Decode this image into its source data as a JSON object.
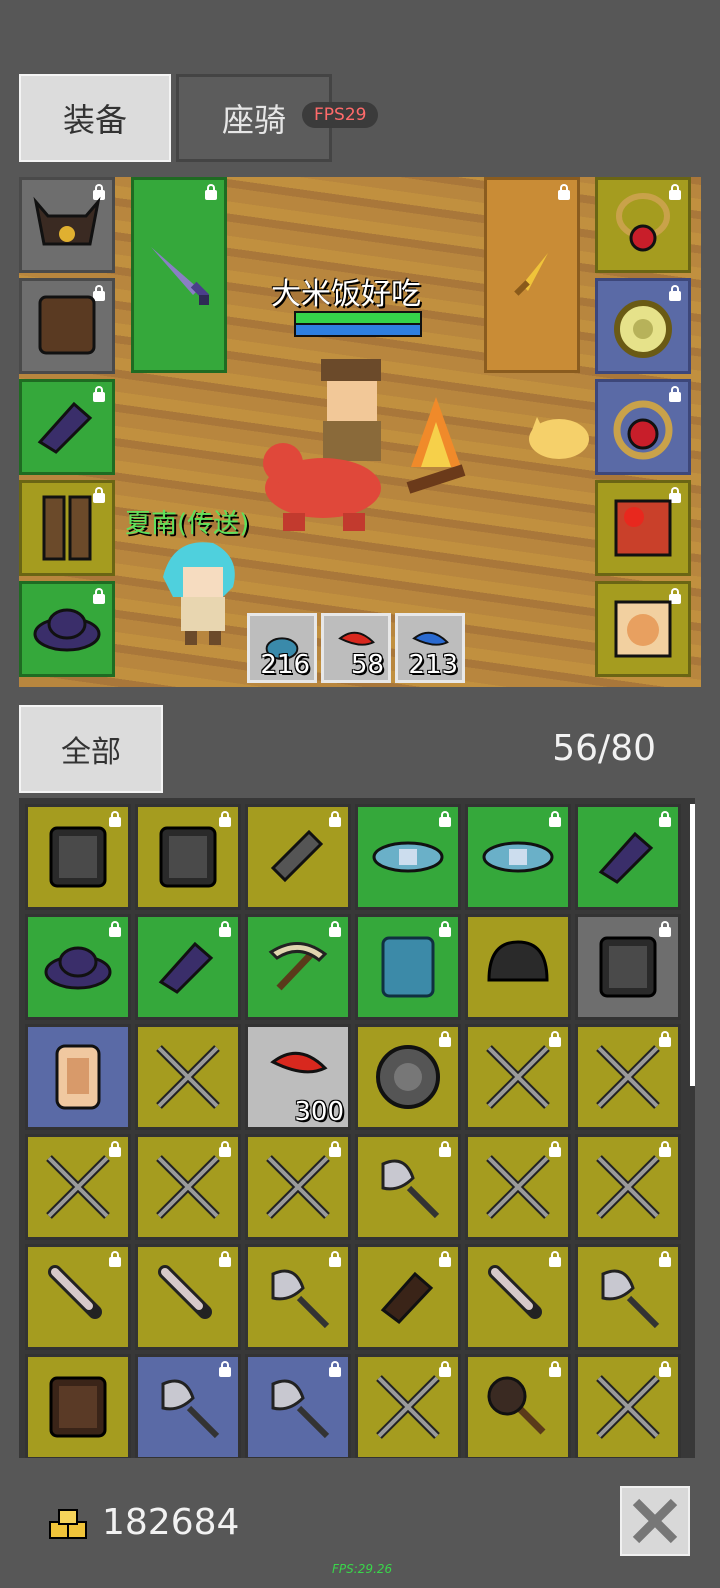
{
  "tabs": {
    "equipment": "装备",
    "mount": "座骑"
  },
  "fps_badge": "FPS29",
  "scene": {
    "player_name": "大米饭好吃",
    "npc_name": "夏南(传送)",
    "hp_color": "#35d34a",
    "mp_color": "#2f7fe0",
    "consumables": [
      {
        "icon": "blue-potion-icon",
        "count": "216"
      },
      {
        "icon": "red-feather-icon",
        "count": "58"
      },
      {
        "icon": "blue-feather-icon",
        "count": "213"
      }
    ]
  },
  "equip_slots_left": [
    {
      "icon": "horned-helmet-icon",
      "rarity": "grey"
    },
    {
      "icon": "leather-armor-icon",
      "rarity": "grey"
    },
    {
      "icon": "purple-gloves-icon",
      "rarity": "green"
    },
    {
      "icon": "leather-boots-icon",
      "rarity": "yellow"
    },
    {
      "icon": "purple-hat-icon",
      "rarity": "green"
    }
  ],
  "equip_slots_right": [
    {
      "icon": "ruby-necklace-icon",
      "rarity": "yellow"
    },
    {
      "icon": "gold-ring-icon",
      "rarity": "blue"
    },
    {
      "icon": "ruby-ring-icon",
      "rarity": "blue"
    },
    {
      "icon": "rose-book-icon",
      "rarity": "yellow"
    },
    {
      "icon": "cat-pet-card-icon",
      "rarity": "yellow"
    }
  ],
  "weapon_slot": {
    "icon": "purple-sword-icon",
    "rarity": "green"
  },
  "offhand_slot": {
    "icon": "gold-dagger-icon",
    "rarity": "orange"
  },
  "inventory": {
    "filter_label": "全部",
    "capacity": "56/80",
    "items": [
      {
        "icon": "dark-chestplate-icon",
        "rarity": "yellow",
        "locked": true
      },
      {
        "icon": "dark-chestplate-icon",
        "rarity": "yellow",
        "locked": true
      },
      {
        "icon": "chain-gauntlet-icon",
        "rarity": "yellow",
        "locked": true
      },
      {
        "icon": "blue-belt-icon",
        "rarity": "green",
        "locked": true
      },
      {
        "icon": "blue-belt-icon",
        "rarity": "green",
        "locked": true
      },
      {
        "icon": "purple-gloves-icon",
        "rarity": "green",
        "locked": true
      },
      {
        "icon": "purple-hat-icon",
        "rarity": "green",
        "locked": true
      },
      {
        "icon": "purple-gloves-icon",
        "rarity": "green",
        "locked": true
      },
      {
        "icon": "pickaxe-icon",
        "rarity": "green",
        "locked": true
      },
      {
        "icon": "blue-armor-icon",
        "rarity": "green",
        "locked": true
      },
      {
        "icon": "iron-helmet-icon",
        "rarity": "yellow",
        "locked": false
      },
      {
        "icon": "dark-chestplate-icon",
        "rarity": "grey",
        "locked": true
      },
      {
        "icon": "scroll-icon",
        "rarity": "blue",
        "locked": false
      },
      {
        "icon": "crossed-spears-icon",
        "rarity": "yellow",
        "locked": false
      },
      {
        "icon": "red-feather-icon",
        "rarity": "lgrey",
        "locked": false,
        "count": "300"
      },
      {
        "icon": "round-shield-icon",
        "rarity": "yellow",
        "locked": true
      },
      {
        "icon": "crossed-spears-icon",
        "rarity": "yellow",
        "locked": true
      },
      {
        "icon": "crossed-spears-icon",
        "rarity": "yellow",
        "locked": true
      },
      {
        "icon": "crossed-spears-icon",
        "rarity": "yellow",
        "locked": true
      },
      {
        "icon": "crossed-spears-icon",
        "rarity": "yellow",
        "locked": true
      },
      {
        "icon": "crossed-spears-icon",
        "rarity": "yellow",
        "locked": true
      },
      {
        "icon": "axe-icon",
        "rarity": "yellow",
        "locked": true
      },
      {
        "icon": "crossed-spears-icon",
        "rarity": "yellow",
        "locked": true
      },
      {
        "icon": "crossed-spears-icon",
        "rarity": "yellow",
        "locked": true
      },
      {
        "icon": "dagger-icon",
        "rarity": "yellow",
        "locked": true
      },
      {
        "icon": "dagger-icon",
        "rarity": "yellow",
        "locked": true
      },
      {
        "icon": "axe-icon",
        "rarity": "yellow",
        "locked": true
      },
      {
        "icon": "brown-gloves-icon",
        "rarity": "yellow",
        "locked": true
      },
      {
        "icon": "dagger-icon",
        "rarity": "yellow",
        "locked": true
      },
      {
        "icon": "axe-icon",
        "rarity": "yellow",
        "locked": true
      },
      {
        "icon": "brown-armor-icon",
        "rarity": "yellow",
        "locked": false
      },
      {
        "icon": "axe-icon",
        "rarity": "blue",
        "locked": true
      },
      {
        "icon": "axe-icon",
        "rarity": "blue",
        "locked": true
      },
      {
        "icon": "crossed-spears-icon",
        "rarity": "yellow",
        "locked": true
      },
      {
        "icon": "mace-icon",
        "rarity": "yellow",
        "locked": true
      },
      {
        "icon": "crossed-spears-icon",
        "rarity": "yellow",
        "locked": true
      }
    ]
  },
  "gold": "182684",
  "fps_footer": "FPS:29.26"
}
